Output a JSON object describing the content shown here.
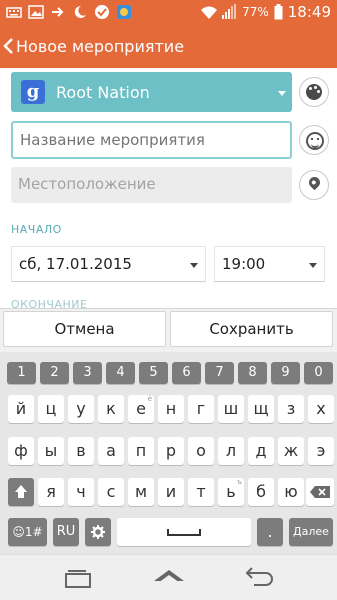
{
  "status_bar": {
    "battery_percent": "77%",
    "time": "18:49",
    "left_icons": [
      "keyboard-icon",
      "image-icon",
      "arrow-icon",
      "night-icon",
      "check-icon",
      "app-icon"
    ],
    "right_icons": [
      "wifi-icon",
      "signal-icon",
      "battery-icon"
    ]
  },
  "header": {
    "back_glyph": "<",
    "title": "Новое мероприятие"
  },
  "form": {
    "calendar_name": "Root Nation",
    "calendar_logo_letter": "g",
    "event_name_placeholder": "Название мероприятия",
    "location_placeholder": "Местоположение",
    "start_label": "НАЧАЛО",
    "start_date": "сб, 17.01.2015",
    "start_time": "19:00",
    "end_label": "ОКОНЧАНИЕ"
  },
  "actions": {
    "cancel": "Отмена",
    "save": "Сохранить"
  },
  "keyboard": {
    "numbers": [
      "1",
      "2",
      "3",
      "4",
      "5",
      "6",
      "7",
      "8",
      "9",
      "0"
    ],
    "row1": [
      "й",
      "ц",
      "у",
      "к",
      "е",
      "н",
      "г",
      "ш",
      "щ",
      "з",
      "х"
    ],
    "row1_hints": [
      "",
      "",
      "",
      "",
      "ё",
      "",
      "",
      "",
      "",
      "",
      ""
    ],
    "row2": [
      "ф",
      "ы",
      "в",
      "а",
      "п",
      "р",
      "о",
      "л",
      "д",
      "ж",
      "э"
    ],
    "row3": [
      "я",
      "ч",
      "с",
      "м",
      "и",
      "т",
      "ь",
      "б",
      "ю"
    ],
    "row3_hints": [
      "",
      "",
      "",
      "",
      "",
      "",
      "ъ",
      "",
      ""
    ],
    "symbols_key": "☺1#",
    "lang_key": "RU",
    "enter_key": "Далее",
    "period_key": "."
  },
  "colors": {
    "accent": "#e56a3a",
    "calendar": "#6cc0c6",
    "section_label": "#5aa9b4"
  }
}
